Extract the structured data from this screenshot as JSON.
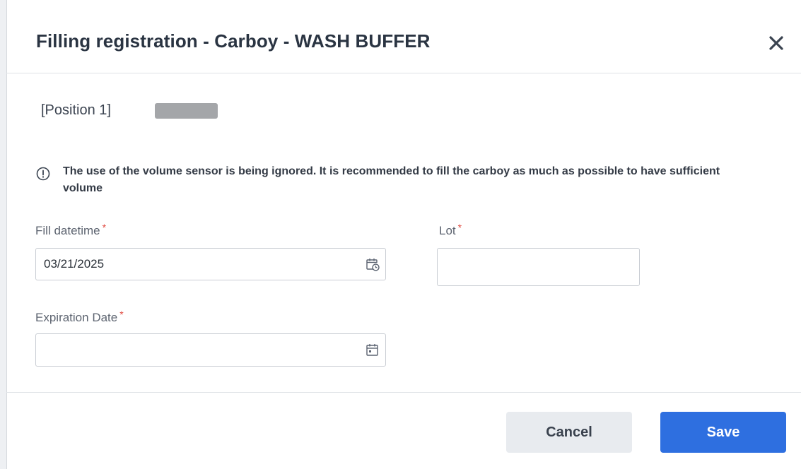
{
  "dialog": {
    "title": "Filling registration - Carboy - WASH BUFFER",
    "close_icon": "close-icon"
  },
  "position": {
    "label": "[Position 1]"
  },
  "notice": {
    "icon": "info-circle-icon",
    "text": "The use of the volume sensor is being ignored. It is recommended to fill the carboy as much as possible to have sufficient volume"
  },
  "form": {
    "fill_datetime": {
      "label": "Fill datetime",
      "required_mark": "*",
      "value": "03/21/2025",
      "icon": "calendar-clock-icon"
    },
    "lot": {
      "label": "Lot",
      "required_mark": "*",
      "value": ""
    },
    "expiration_date": {
      "label": "Expiration Date",
      "required_mark": "*",
      "value": "",
      "icon": "calendar-icon"
    }
  },
  "footer": {
    "cancel_label": "Cancel",
    "save_label": "Save"
  },
  "colors": {
    "primary": "#2e6fe0",
    "required": "#e0483e",
    "title": "#2a3442"
  }
}
